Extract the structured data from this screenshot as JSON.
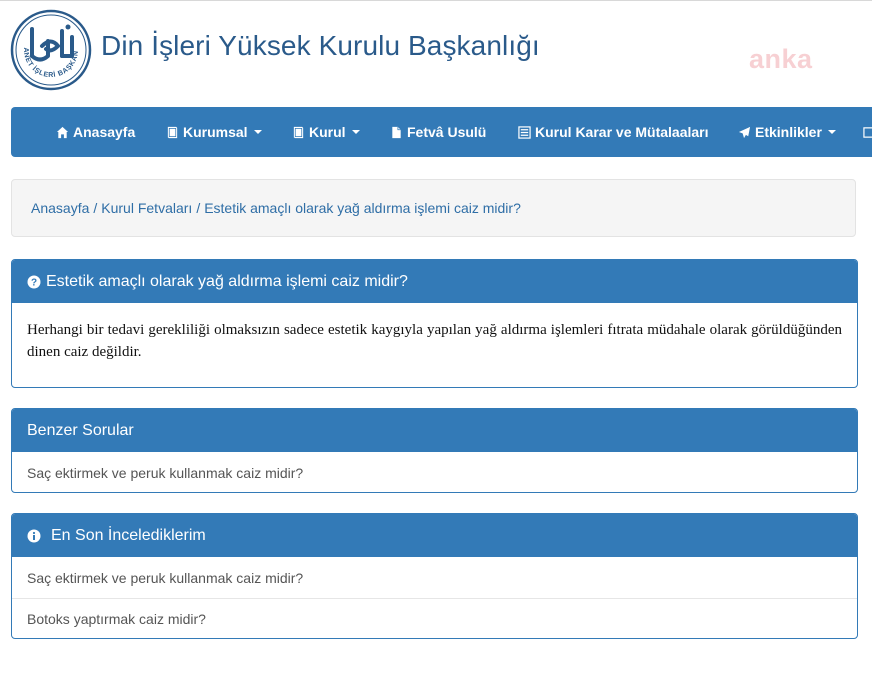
{
  "header": {
    "site_title": "Din İşleri Yüksek Kurulu Başkanlığı",
    "logo_text": "DİYANET İŞLERİ BAŞKANLIĞI",
    "watermark": "anka"
  },
  "nav": {
    "items": [
      {
        "label": "Anasayfa",
        "icon": "home-icon",
        "dropdown": false
      },
      {
        "label": "Kurumsal",
        "icon": "book-icon",
        "dropdown": true
      },
      {
        "label": "Kurul",
        "icon": "book-icon",
        "dropdown": true
      },
      {
        "label": "Fetvâ Usulü",
        "icon": "file-icon",
        "dropdown": false
      },
      {
        "label": "Kurul Karar ve Mütalaaları",
        "icon": "list-icon",
        "dropdown": false
      },
      {
        "label": "Etkinlikler",
        "icon": "paper-plane-icon",
        "dropdown": true
      }
    ]
  },
  "breadcrumb": {
    "items": [
      "Anasayfa",
      "Kurul Fetvaları",
      "Estetik amaçlı olarak yağ aldırma işlemi caiz midir?"
    ],
    "separator": "/"
  },
  "question_panel": {
    "title": "Estetik amaçlı olarak yağ aldırma işlemi caiz midir?",
    "icon": "question-circle-icon",
    "body": "Herhangi bir tedavi gerekliliği olmaksızın sadece estetik kaygıyla yapılan yağ aldırma işlemleri fıtrata müdahale olarak görüldüğünden dinen caiz değildir."
  },
  "similar_panel": {
    "title": "Benzer Sorular",
    "items": [
      "Saç ektirmek ve peruk kullanmak caiz midir?"
    ]
  },
  "recent_panel": {
    "title": "En Son İncelediklerim",
    "icon": "info-circle-icon",
    "items": [
      "Saç ektirmek ve peruk kullanmak caiz midir?",
      "Botoks yaptırmak caiz midir?"
    ]
  },
  "colors": {
    "primary": "#337ab7",
    "title": "#2a5a8a",
    "breadcrumb_bg": "#f5f5f5"
  }
}
